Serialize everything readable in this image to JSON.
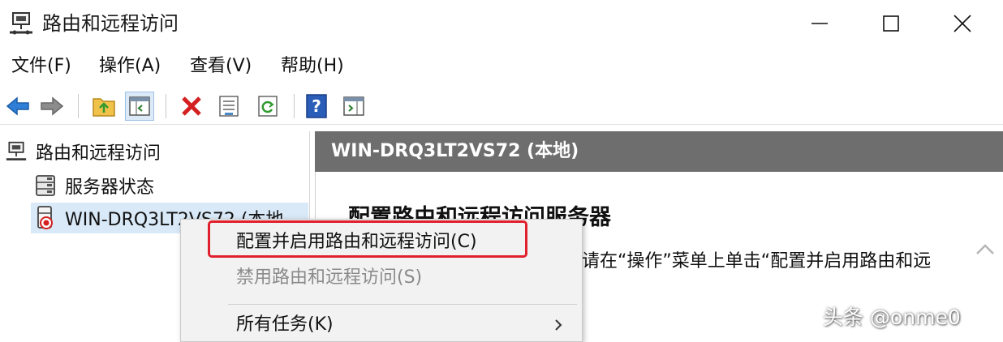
{
  "window": {
    "title": "路由和远程访问",
    "icon": "routing-remote-access-icon"
  },
  "menu": [
    "文件(F)",
    "操作(A)",
    "查看(V)",
    "帮助(H)"
  ],
  "toolbar": {
    "buttons": [
      "back-arrow-icon",
      "forward-arrow-icon",
      "up-folder-icon",
      "show-hide-tree-icon",
      "delete-icon",
      "properties-icon",
      "refresh-icon",
      "help-icon",
      "action-pane-icon"
    ]
  },
  "tree": {
    "root": "路由和远程访问",
    "items": [
      "服务器状态",
      "WIN-DRQ3LT2VS72 (本地"
    ]
  },
  "right_pane": {
    "header": "WIN-DRQ3LT2VS72 (本地)",
    "heading": "配置路由和远程访问服务器",
    "text": "请在“操作”菜单上单击“配置并启用路由和远"
  },
  "context_menu": {
    "items": [
      {
        "label": "配置并启用路由和远程访问(C)",
        "enabled": true
      },
      {
        "label": "禁用路由和远程访问(S)",
        "enabled": false
      },
      {
        "label": "所有任务(K)",
        "enabled": true,
        "submenu": true
      }
    ]
  },
  "colors": {
    "header_bg": "#6e6e6e",
    "highlight": "#e0202c",
    "selection": "#d9e9f7"
  },
  "watermark": "头条 @onme0"
}
